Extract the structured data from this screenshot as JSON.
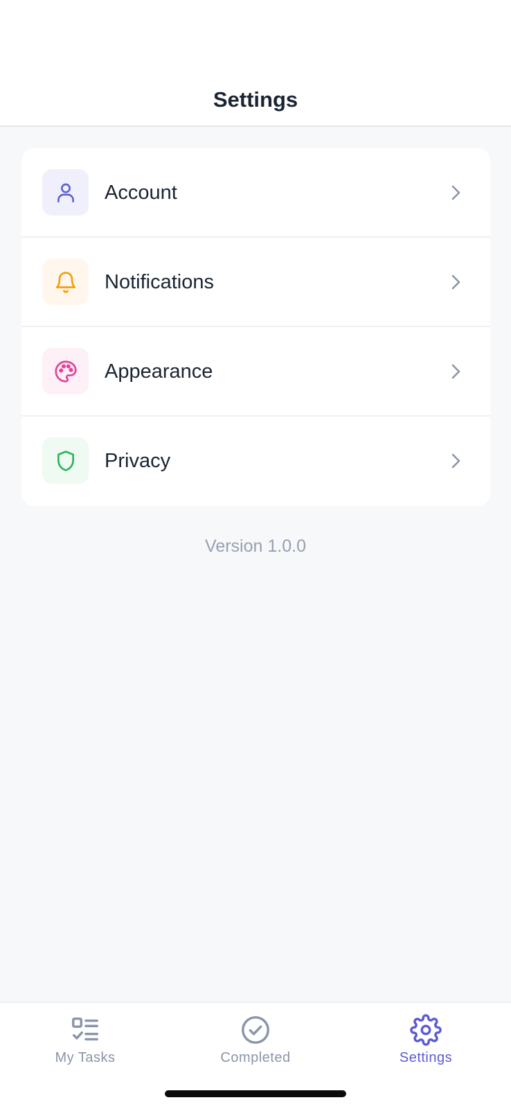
{
  "header": {
    "title": "Settings"
  },
  "settings": {
    "items": [
      {
        "label": "Account",
        "icon": "user-icon",
        "icon_color": "#5b5bd6",
        "icon_bg": "#f0f0fd"
      },
      {
        "label": "Notifications",
        "icon": "bell-icon",
        "icon_color": "#f59e0b",
        "icon_bg": "#fff7ed"
      },
      {
        "label": "Appearance",
        "icon": "palette-icon",
        "icon_color": "#e0439a",
        "icon_bg": "#fdf0f6"
      },
      {
        "label": "Privacy",
        "icon": "shield-icon",
        "icon_color": "#22b455",
        "icon_bg": "#eefaf2"
      }
    ]
  },
  "version": "Version 1.0.0",
  "tabbar": {
    "tabs": [
      {
        "label": "My Tasks",
        "icon": "task-list-icon",
        "active": false
      },
      {
        "label": "Completed",
        "icon": "check-circle-icon",
        "active": false
      },
      {
        "label": "Settings",
        "icon": "gear-icon",
        "active": true
      }
    ],
    "active_color": "#5b5bd6",
    "inactive_color": "#8a95a8"
  }
}
